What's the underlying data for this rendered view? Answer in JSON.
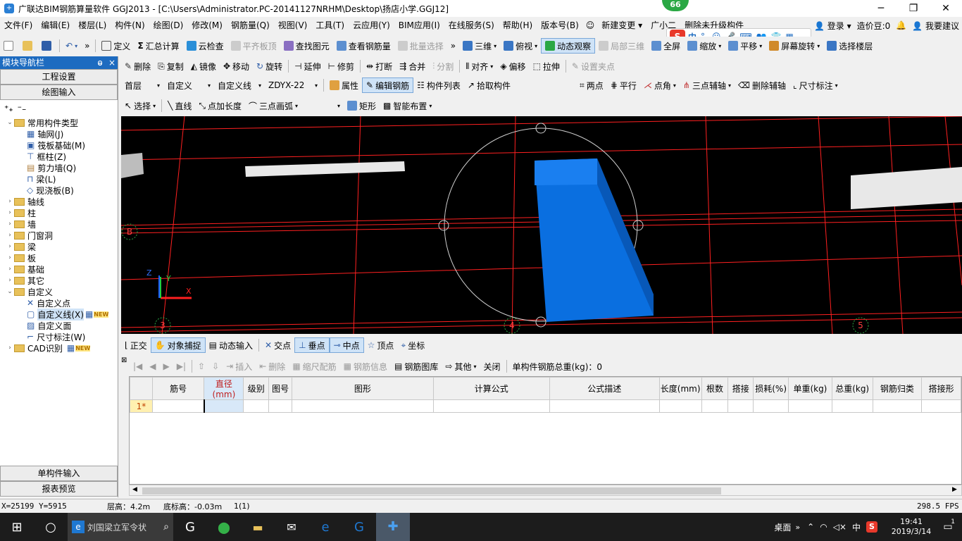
{
  "window": {
    "title": "广联达BIM钢筋算量软件 GGJ2013 - [C:\\Users\\Administrator.PC-20141127NRHM\\Desktop\\扬店小学.GGJ12]",
    "badge": "66"
  },
  "menu": [
    "文件(F)",
    "编辑(E)",
    "楼层(L)",
    "构件(N)",
    "绘图(D)",
    "修改(M)",
    "钢筋量(Q)",
    "视图(V)",
    "工具(T)",
    "云应用(Y)",
    "BIM应用(I)",
    "在线服务(S)",
    "帮助(H)",
    "版本号(B)"
  ],
  "menu_right": {
    "new_change": "新建变更",
    "guangxiaoer": "广小二",
    "delete_unupgraded": "删除未升级构件",
    "login": "登录",
    "zaojiadou": "造价豆:0",
    "suggest": "我要建议"
  },
  "toolbar1": {
    "define": "定义",
    "sum_calc": "汇总计算",
    "cloud_check": "云检查",
    "flat_top": "平齐板顶",
    "find_elem": "查找图元",
    "view_rebar": "查看钢筋量",
    "batch_select": "批量选择",
    "view_3d": "三维",
    "top_view": "俯视",
    "dynamic_view": "动态观察",
    "local_3d": "局部三维",
    "fullscreen": "全屏",
    "zoom": "缩放",
    "pan": "平移",
    "screen_rotate": "屏幕旋转",
    "select_floor": "选择楼层"
  },
  "toolbar2": {
    "delete": "删除",
    "copy": "复制",
    "mirror": "镜像",
    "move": "移动",
    "rotate": "旋转",
    "extend": "延伸",
    "trim": "修剪",
    "break": "打断",
    "merge": "合并",
    "split": "分割",
    "align": "对齐",
    "offset": "偏移",
    "stretch": "拉伸",
    "set_grip": "设置夹点"
  },
  "toolbar3": {
    "floor": "首层",
    "category": "自定义",
    "type": "自定义线",
    "name": "ZDYX-22",
    "property": "属性",
    "edit_rebar": "编辑钢筋",
    "elem_list": "构件列表",
    "pick_elem": "拾取构件",
    "two_points": "两点",
    "parallel": "平行",
    "point_angle": "点角",
    "three_point_aux": "三点辅轴",
    "delete_aux": "删除辅轴",
    "dim_mark": "尺寸标注"
  },
  "toolbar4": {
    "select": "选择",
    "line": "直线",
    "point_length": "点加长度",
    "three_point_arc": "三点画弧",
    "rect": "矩形",
    "smart_layout": "智能布置"
  },
  "left_panel": {
    "header": "模块导航栏",
    "pin": "ᵖ",
    "close": "×",
    "btn_project": "工程设置",
    "btn_draw": "绘图输入",
    "btn_single": "单构件输入",
    "btn_report": "报表预览",
    "tree": [
      {
        "label": "常用构件类型",
        "level": 0,
        "kind": "folder-open"
      },
      {
        "label": "轴网(J)",
        "level": 1,
        "kind": "item"
      },
      {
        "label": "筏板基础(M)",
        "level": 1,
        "kind": "item"
      },
      {
        "label": "框柱(Z)",
        "level": 1,
        "kind": "item"
      },
      {
        "label": "剪力墙(Q)",
        "level": 1,
        "kind": "item"
      },
      {
        "label": "梁(L)",
        "level": 1,
        "kind": "item"
      },
      {
        "label": "现浇板(B)",
        "level": 1,
        "kind": "item"
      },
      {
        "label": "轴线",
        "level": 0,
        "kind": "folder"
      },
      {
        "label": "柱",
        "level": 0,
        "kind": "folder"
      },
      {
        "label": "墙",
        "level": 0,
        "kind": "folder"
      },
      {
        "label": "门窗洞",
        "level": 0,
        "kind": "folder"
      },
      {
        "label": "梁",
        "level": 0,
        "kind": "folder"
      },
      {
        "label": "板",
        "level": 0,
        "kind": "folder"
      },
      {
        "label": "基础",
        "level": 0,
        "kind": "folder"
      },
      {
        "label": "其它",
        "level": 0,
        "kind": "folder"
      },
      {
        "label": "自定义",
        "level": 0,
        "kind": "folder-open"
      },
      {
        "label": "自定义点",
        "level": 1,
        "kind": "item"
      },
      {
        "label": "自定义线(X)",
        "level": 1,
        "kind": "item-selected"
      },
      {
        "label": "自定义面",
        "level": 1,
        "kind": "item"
      },
      {
        "label": "尺寸标注(W)",
        "level": 1,
        "kind": "item"
      },
      {
        "label": "CAD识别",
        "level": 0,
        "kind": "folder"
      }
    ],
    "new_tag": "NEW"
  },
  "viewport": {
    "axis_labels": [
      "B",
      "3",
      "4",
      "5"
    ],
    "gizmo": {
      "x": "X",
      "y": "Y",
      "z": "Z"
    }
  },
  "snapbar": {
    "ortho": "正交",
    "obj_snap": "对象捕捉",
    "dyn_input": "动态输入",
    "intersection": "交点",
    "perpendicular": "垂点",
    "midpoint": "中点",
    "vertex": "顶点",
    "coord": "坐标"
  },
  "gridbar": {
    "insert": "插入",
    "delete": "删除",
    "scale_rebar": "缩尺配筋",
    "rebar_info": "钢筋信息",
    "rebar_lib": "钢筋图库",
    "other": "其他",
    "close": "关闭",
    "total_weight": "单构件钢筋总重(kg)：0"
  },
  "grid": {
    "columns": [
      "筋号",
      "直径(mm)",
      "级别",
      "图号",
      "图形",
      "计算公式",
      "公式描述",
      "长度(mm)",
      "根数",
      "搭接",
      "损耗(%)",
      "单重(kg)",
      "总重(kg)",
      "钢筋归类",
      "搭接形"
    ],
    "row_label": "1*"
  },
  "status": {
    "coords": "X=25199 Y=5915",
    "floor_height": "层高：4.2m",
    "base_elev": "底标高：-0.03m",
    "count": "1(1)",
    "fps": "298.5 FPS"
  },
  "taskbar": {
    "search_text": "刘国梁立军令状",
    "desktop": "桌面",
    "ime": "中",
    "time": "19:41",
    "date": "2019/3/14",
    "notif": "1"
  },
  "colors": {
    "accent": "#1d6bc0",
    "viewport_bg": "#000000",
    "grid_red": "#ff2020",
    "column_blue": "#0a6fe0"
  }
}
